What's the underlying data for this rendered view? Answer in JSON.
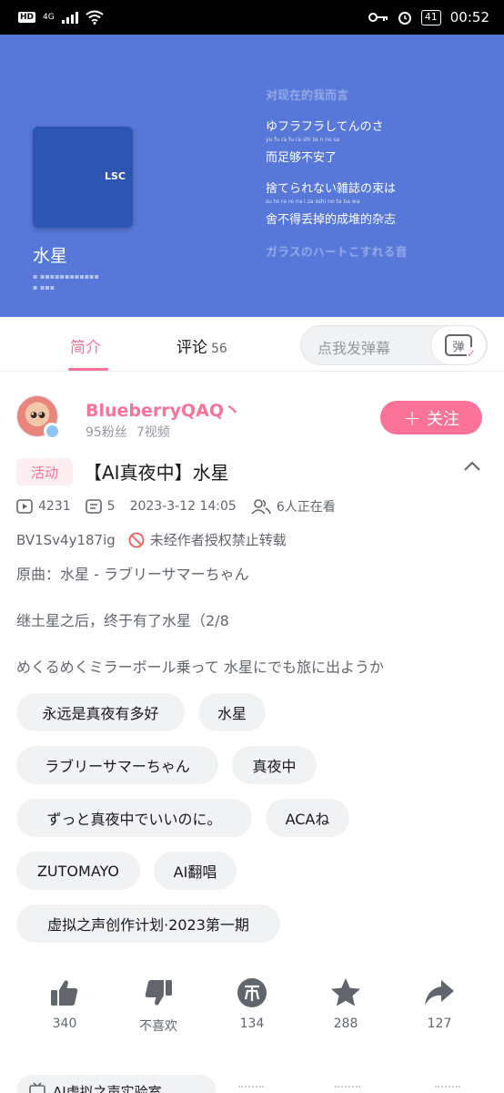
{
  "status_bar": {
    "hd": "HD",
    "network": "4G",
    "battery": "41",
    "time": "00:52"
  },
  "player": {
    "album_logo": "LSC",
    "song_title": "水星",
    "lyrics": [
      {
        "text": "对现在的我而言",
        "romaji": "",
        "faded": true
      },
      {
        "text": "ゆフラフラしてんのさ",
        "romaji": "yu fu ra fu ra shi te n no sa",
        "faded": false
      },
      {
        "text": "而足够不安了",
        "romaji": "",
        "faded": false
      },
      {
        "text": "捨てられない雑誌の束は",
        "romaji": "su te ra re na i za sshi no ta ba wa",
        "faded": false
      },
      {
        "text": "舍不得丢掉的成堆的杂志",
        "romaji": "",
        "faded": false
      },
      {
        "text": "ガラスのハートこすれる音",
        "romaji": "",
        "faded": true
      }
    ],
    "progress": 0.48
  },
  "tabs": {
    "intro": "简介",
    "comments": "评论",
    "comments_count": "56",
    "danmaku_placeholder": "点我发弹幕",
    "danmaku_icon_char": "弹"
  },
  "uploader": {
    "name": "BlueberryQAQ丶",
    "fans": "95粉丝",
    "videos": "7视频",
    "follow_label": "关注",
    "follow_plus": "+"
  },
  "video": {
    "badge": "活动",
    "title": "【AI真夜中】水星",
    "plays": "4231",
    "danmaku_count": "5",
    "date": "2023-3-12 14:05",
    "watching": "6人正在看",
    "bvid": "BV1Sv4y187ig",
    "no_repost": "未经作者授权禁止转载",
    "original": "原曲：水星 - ラブリーサマーちゃん",
    "desc_line1": "继土星之后，终于有了水星（2/8",
    "desc_line2": "めくるめくミラーボール乗って 水星にでも旅に出ようか"
  },
  "tags": [
    "永远是真夜有多好",
    "水星",
    "ラブリーサマーちゃん",
    "真夜中",
    "ずっと真夜中でいいのに。",
    "ACAね",
    "ZUTOMAYO",
    "AI翻唱",
    "虚拟之声创作计划·2023第一期"
  ],
  "actions": {
    "like": "340",
    "dislike": "不喜欢",
    "coin": "134",
    "favorite": "288",
    "share": "127"
  },
  "bottom": {
    "peek_label": "AI虚拟之声实验室"
  },
  "colors": {
    "accent": "#fb7299",
    "video_bg": "#5778d9",
    "text_secondary": "#61666d",
    "chip_bg": "#f1f2f3"
  }
}
